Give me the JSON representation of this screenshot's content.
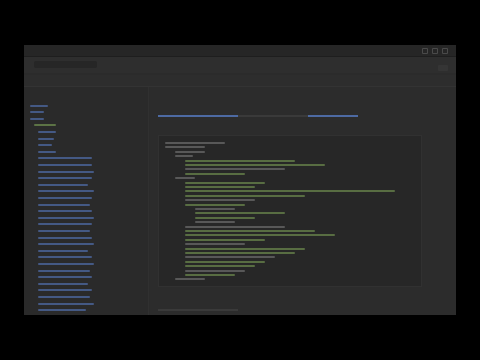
{
  "window": {
    "title": "",
    "actions": [
      "minimize",
      "maximize",
      "close"
    ]
  },
  "topbar": {
    "address": "",
    "page_link": "",
    "right_text": "",
    "button_label": ""
  },
  "navbar": {
    "items": [
      "",
      "",
      "",
      ""
    ]
  },
  "sidebar": {
    "items": [
      {
        "label": "",
        "color": "#4d6aa3"
      },
      {
        "label": "",
        "color": "#4d6aa3"
      },
      {
        "label": "",
        "color": "#4d6aa3"
      },
      {
        "label": "",
        "color": "#6d8c4f"
      },
      {
        "label": "",
        "color": "#4d6aa3"
      },
      {
        "label": "",
        "color": "#4d6aa3"
      },
      {
        "label": "",
        "color": "#4d6aa3"
      },
      {
        "label": "",
        "color": "#4d6aa3"
      },
      {
        "label": "",
        "color": "#4d6aa3"
      },
      {
        "label": "",
        "color": "#4d6aa3"
      },
      {
        "label": "",
        "color": "#4d6aa3"
      },
      {
        "label": "",
        "color": "#4d6aa3"
      },
      {
        "label": "",
        "color": "#4d6aa3"
      },
      {
        "label": "",
        "color": "#4d6aa3"
      },
      {
        "label": "",
        "color": "#4d6aa3"
      },
      {
        "label": "",
        "color": "#4d6aa3"
      },
      {
        "label": "",
        "color": "#4d6aa3"
      },
      {
        "label": "",
        "color": "#4d6aa3"
      },
      {
        "label": "",
        "color": "#4d6aa3"
      },
      {
        "label": "",
        "color": "#4d6aa3"
      },
      {
        "label": "",
        "color": "#4d6aa3"
      },
      {
        "label": "",
        "color": "#4d6aa3"
      },
      {
        "label": "",
        "color": "#4d6aa3"
      },
      {
        "label": "",
        "color": "#4d6aa3"
      },
      {
        "label": "",
        "color": "#4d6aa3"
      },
      {
        "label": "",
        "color": "#4d6aa3"
      },
      {
        "label": "",
        "color": "#4d6aa3"
      },
      {
        "label": "",
        "color": "#4d6aa3"
      },
      {
        "label": "",
        "color": "#4d6aa3"
      },
      {
        "label": "",
        "color": "#4d6aa3"
      },
      {
        "label": "",
        "color": "#4d6aa3"
      },
      {
        "label": "",
        "color": "#4d6aa3"
      }
    ]
  },
  "main": {
    "title": "",
    "section1": "",
    "section2": "",
    "bottom_label": ""
  },
  "colors": {
    "accent": "#4f6ba2",
    "code_text": "#6e6e6e",
    "code_string": "#6d8c4f"
  }
}
